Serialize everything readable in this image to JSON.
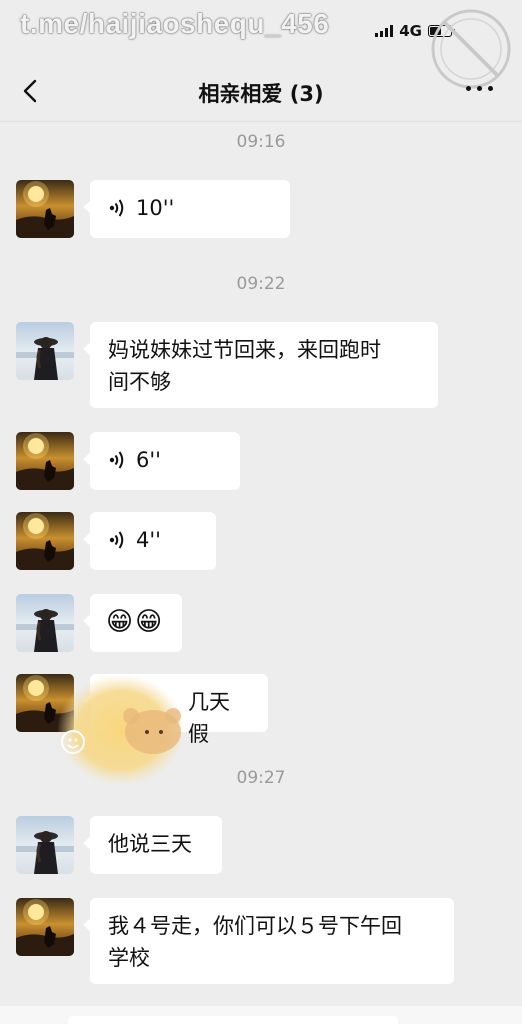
{
  "status": {
    "watermark": "t.me/haijiaoshequ_456",
    "network": "4G"
  },
  "header": {
    "title": "相亲相爱 (3)"
  },
  "messages": [
    {
      "type": "time",
      "text": "09:16"
    },
    {
      "type": "voice",
      "sender": "sunset",
      "duration": "10''"
    },
    {
      "type": "time",
      "text": "09:22"
    },
    {
      "type": "text",
      "sender": "girl",
      "lines": [
        "妈说妹妹过节回来，来回跑时",
        "间不够"
      ]
    },
    {
      "type": "voice",
      "sender": "sunset",
      "duration": "6''"
    },
    {
      "type": "voice",
      "sender": "sunset",
      "duration": "4''"
    },
    {
      "type": "emoji",
      "sender": "girl",
      "text": "😁😁"
    },
    {
      "type": "text",
      "sender": "sunset",
      "lines": [
        "几天假"
      ]
    },
    {
      "type": "time",
      "text": "09:27"
    },
    {
      "type": "text",
      "sender": "girl",
      "lines": [
        "他说三天"
      ]
    },
    {
      "type": "text",
      "sender": "sunset",
      "lines": [
        "我４号走，你们可以５号下午回",
        "学校"
      ]
    }
  ],
  "icons": {
    "back": "chevron-left-icon",
    "more": "more-dots-icon",
    "voice": "voice-wave-icon"
  },
  "colors": {
    "background": "#ededed",
    "bubble": "#ffffff",
    "timestamp": "#9a9a9a"
  }
}
